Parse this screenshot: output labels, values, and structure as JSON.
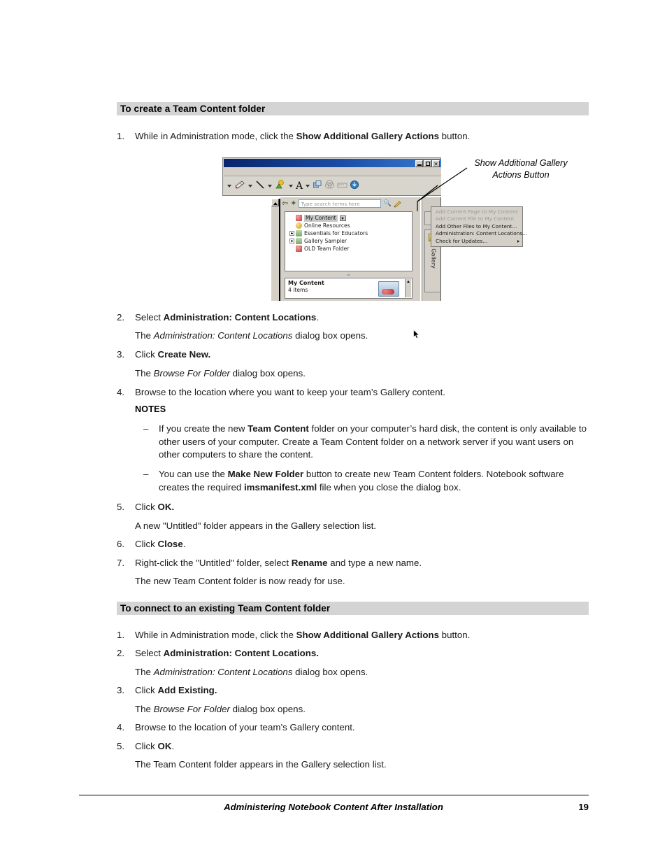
{
  "sections": [
    {
      "heading": "To create a Team Content folder",
      "steps": [
        {
          "num": "1.",
          "html": "While in Administration mode, click the <b>Show Additional Gallery Actions</b> button."
        },
        {
          "num": "2.",
          "html": "Select <b>Administration: Content Locations</b>."
        },
        {
          "num": "",
          "html": "The <i>Administration: Content Locations</i> dialog box opens."
        },
        {
          "num": "3.",
          "html": "Click <b>Create New.</b>"
        },
        {
          "num": "",
          "html": "The <i>Browse For Folder</i> dialog box opens."
        },
        {
          "num": "4.",
          "html": "Browse to the location where you want to keep your team’s Gallery content."
        },
        {
          "num": "5.",
          "html": "Click <b>OK.</b>"
        },
        {
          "num": "",
          "html": "A new \"Untitled\" folder appears in the Gallery selection list."
        },
        {
          "num": "6.",
          "html": "Click <b>Close</b>."
        },
        {
          "num": "7.",
          "html": "Right-click the \"Untitled\" folder, select <b>Rename</b> and type a new name."
        },
        {
          "num": "",
          "html": "The new Team Content folder is now ready for use."
        }
      ]
    },
    {
      "heading": "To connect to an existing Team Content folder",
      "steps": [
        {
          "num": "1.",
          "html": "While in Administration mode, click the <b>Show Additional Gallery Actions</b> button."
        },
        {
          "num": "2.",
          "html": "Select <b>Administration: Content Locations.</b>"
        },
        {
          "num": "",
          "html": "The <i>Administration: Content Locations</i> dialog box opens."
        },
        {
          "num": "3.",
          "html": "Click <b>Add Existing.</b>"
        },
        {
          "num": "",
          "html": "The <i>Browse For Folder</i> dialog box opens."
        },
        {
          "num": "4.",
          "html": "Browse to the location of your team’s Gallery content."
        },
        {
          "num": "5.",
          "html": "Click <b>OK</b>."
        },
        {
          "num": "",
          "html": "The Team Content folder appears in the Gallery selection list."
        }
      ]
    }
  ],
  "notes": {
    "title": "NOTES",
    "items": [
      {
        "dash": "–",
        "html": "If you create the new <b>Team Content</b> folder on your computer’s hard disk, the content is only available to other users of your computer. Create a Team Content folder on a network server if you want users on other computers to share the content."
      },
      {
        "dash": "–",
        "html": "You can use the <b>Make New Folder</b> button to create new Team Content folders. Notebook software creates the required <b>imsmanifest.xml</b> file when you close the dialog box."
      }
    ]
  },
  "figure": {
    "annotation_line1": "Show Additional Gallery",
    "annotation_line2": "Actions Button",
    "window": {
      "minimize_label": "_",
      "maximize_label": "□",
      "close_label": "✕"
    },
    "search": {
      "placeholder": "Type search terms here",
      "value": "Type search terms here"
    },
    "tree": [
      {
        "label": "My Content",
        "icon": "red-folder-icon",
        "expander": "none",
        "selected": true,
        "has_dropdown": true
      },
      {
        "label": "Online Resources",
        "icon": "globe-icon",
        "expander": "none",
        "selected": false,
        "has_dropdown": false
      },
      {
        "label": "Essentials for Educators",
        "icon": "green-folder-icon",
        "expander": "plus",
        "selected": false,
        "has_dropdown": false
      },
      {
        "label": "Gallery Sampler",
        "icon": "green-folder-icon",
        "expander": "plus",
        "selected": false,
        "has_dropdown": false
      },
      {
        "label": "OLD Team Folder",
        "icon": "red-folder-icon",
        "expander": "none",
        "selected": false,
        "has_dropdown": false
      }
    ],
    "preview": {
      "title": "My Content",
      "subtitle": "4 items"
    },
    "side_tab_label": "Gallery",
    "popup_menu": [
      {
        "label": "Add Current Page to My Content",
        "disabled": true,
        "submenu": false
      },
      {
        "label": "Add Current File to My Content",
        "disabled": true,
        "submenu": false
      },
      {
        "label": "Add Other Files to My Content...",
        "disabled": false,
        "submenu": false
      },
      {
        "label": "Administration: Content Locations...",
        "disabled": false,
        "submenu": false
      },
      {
        "label": "Check for Updates...",
        "disabled": false,
        "submenu": true
      }
    ]
  },
  "footer": {
    "title": "Administering Notebook Content After Installation",
    "page": "19"
  },
  "colors": {
    "section_band": "#d4d4d4",
    "titlebar": "#0a246a",
    "window_face": "#d4d0c8"
  }
}
